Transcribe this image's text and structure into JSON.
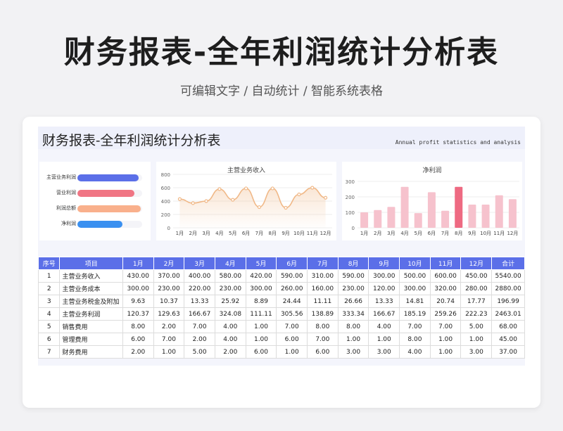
{
  "title": "财务报表-全年利润统计分析表",
  "subtitle": "可编辑文字 / 自动统计 / 智能系统表格",
  "sheet": {
    "title": "财务报表-全年利润统计分析表",
    "title_en": "Annual profit statistics and analysis"
  },
  "bar_panel": {
    "items": [
      {
        "label": "主营业务利润",
        "value": 0.95,
        "color": "#5b6fe8"
      },
      {
        "label": "营业利润",
        "value": 0.88,
        "color": "#f07584"
      },
      {
        "label": "利润总额",
        "value": 0.98,
        "color": "#f9b08c"
      },
      {
        "label": "净利润",
        "value": 0.7,
        "color": "#3a90f0"
      }
    ]
  },
  "chart_data": [
    {
      "type": "area",
      "title": "主营业务收入",
      "categories": [
        "1月",
        "2月",
        "3月",
        "4月",
        "5月",
        "6月",
        "7月",
        "8月",
        "9月",
        "10月",
        "11月",
        "12月"
      ],
      "values": [
        430,
        370,
        400,
        580,
        420,
        590,
        310,
        590,
        300,
        500,
        600,
        450
      ],
      "ylim": [
        0,
        800
      ],
      "yticks": [
        0,
        200,
        400,
        600,
        800
      ],
      "color": "#f0b887"
    },
    {
      "type": "bar",
      "title": "净利润",
      "categories": [
        "1月",
        "2月",
        "3月",
        "4月",
        "5月",
        "6月",
        "7月",
        "8月",
        "9月",
        "10月",
        "11月",
        "12月"
      ],
      "values": [
        100,
        115,
        135,
        265,
        95,
        230,
        110,
        265,
        150,
        150,
        210,
        185
      ],
      "ylim": [
        0,
        300
      ],
      "yticks": [
        0,
        100,
        200,
        300
      ],
      "color": "#f6c2cd",
      "highlight_color": "#ee6a82",
      "highlight_index": 7
    }
  ],
  "table": {
    "headers": [
      "序号",
      "项目",
      "1月",
      "2月",
      "3月",
      "4月",
      "5月",
      "6月",
      "7月",
      "8月",
      "9月",
      "10月",
      "11月",
      "12月",
      "合计"
    ],
    "rows": [
      [
        "1",
        "主营业务收入",
        "430.00",
        "370.00",
        "400.00",
        "580.00",
        "420.00",
        "590.00",
        "310.00",
        "590.00",
        "300.00",
        "500.00",
        "600.00",
        "450.00",
        "5540.00"
      ],
      [
        "2",
        "主营业务成本",
        "300.00",
        "230.00",
        "220.00",
        "230.00",
        "300.00",
        "260.00",
        "160.00",
        "230.00",
        "120.00",
        "300.00",
        "320.00",
        "280.00",
        "2880.00"
      ],
      [
        "3",
        "主营业务税金及附加",
        "9.63",
        "10.37",
        "13.33",
        "25.92",
        "8.89",
        "24.44",
        "11.11",
        "26.66",
        "13.33",
        "14.81",
        "20.74",
        "17.77",
        "196.99"
      ],
      [
        "4",
        "主营业务利润",
        "120.37",
        "129.63",
        "166.67",
        "324.08",
        "111.11",
        "305.56",
        "138.89",
        "333.34",
        "166.67",
        "185.19",
        "259.26",
        "222.23",
        "2463.01"
      ],
      [
        "5",
        "销售费用",
        "8.00",
        "2.00",
        "7.00",
        "4.00",
        "1.00",
        "7.00",
        "8.00",
        "8.00",
        "4.00",
        "7.00",
        "7.00",
        "5.00",
        "68.00"
      ],
      [
        "6",
        "管理费用",
        "6.00",
        "7.00",
        "2.00",
        "4.00",
        "1.00",
        "6.00",
        "7.00",
        "1.00",
        "1.00",
        "8.00",
        "1.00",
        "1.00",
        "45.00"
      ],
      [
        "7",
        "财务费用",
        "2.00",
        "1.00",
        "5.00",
        "2.00",
        "6.00",
        "1.00",
        "6.00",
        "3.00",
        "3.00",
        "4.00",
        "1.00",
        "3.00",
        "37.00"
      ]
    ]
  }
}
